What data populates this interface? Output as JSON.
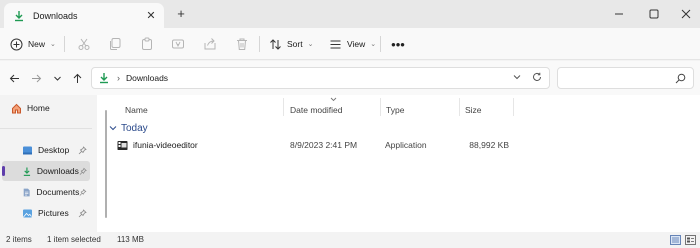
{
  "window": {
    "tab_title": "Downloads",
    "tab_close": "✕",
    "new_tab": "+",
    "minimize": "—",
    "maximize": "☐",
    "close": "✕",
    "accent_color": "#5e3dab",
    "folder_icon_color": "#1f9a53"
  },
  "toolbar": {
    "new_label": "New",
    "sort_label": "Sort",
    "view_label": "View",
    "more_label": "•••"
  },
  "navigation": {
    "address_path": "Downloads",
    "address_separator": "›",
    "search_placeholder": ""
  },
  "sidebar": {
    "home": "Home",
    "items": [
      {
        "label": "Desktop",
        "icon": "desktop-icon"
      },
      {
        "label": "Downloads",
        "icon": "download-icon",
        "selected": true
      },
      {
        "label": "Documents",
        "icon": "document-icon"
      },
      {
        "label": "Pictures",
        "icon": "pictures-icon"
      }
    ]
  },
  "columns": {
    "name": "Name",
    "date_modified": "Date modified",
    "type": "Type",
    "size": "Size"
  },
  "group": {
    "label": "Today"
  },
  "files": [
    {
      "name": "ifunia-videoeditor",
      "date_modified": "8/9/2023 2:41 PM",
      "type": "Application",
      "size": "88,992 KB",
      "icon": "application-icon"
    }
  ],
  "status": {
    "item_count": "2 items",
    "selected": "1 item selected",
    "selected_size": "113 MB"
  }
}
